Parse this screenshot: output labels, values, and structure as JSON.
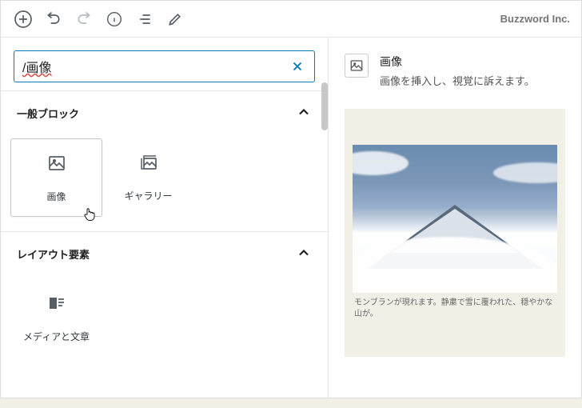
{
  "brand": "Buzzword Inc.",
  "search": {
    "value": "/画像"
  },
  "sections": [
    {
      "title": "一般ブロック",
      "blocks": [
        {
          "label": "画像",
          "icon": "image"
        },
        {
          "label": "ギャラリー",
          "icon": "gallery"
        }
      ]
    },
    {
      "title": "レイアウト要素",
      "blocks": [
        {
          "label": "メディアと文章",
          "icon": "media-text"
        }
      ]
    }
  ],
  "preview": {
    "title": "画像",
    "description": "画像を挿入し、視覚に訴えます。",
    "caption": "モンブランが現れます。静粛で雪に覆われた、穏やかな山が。"
  }
}
